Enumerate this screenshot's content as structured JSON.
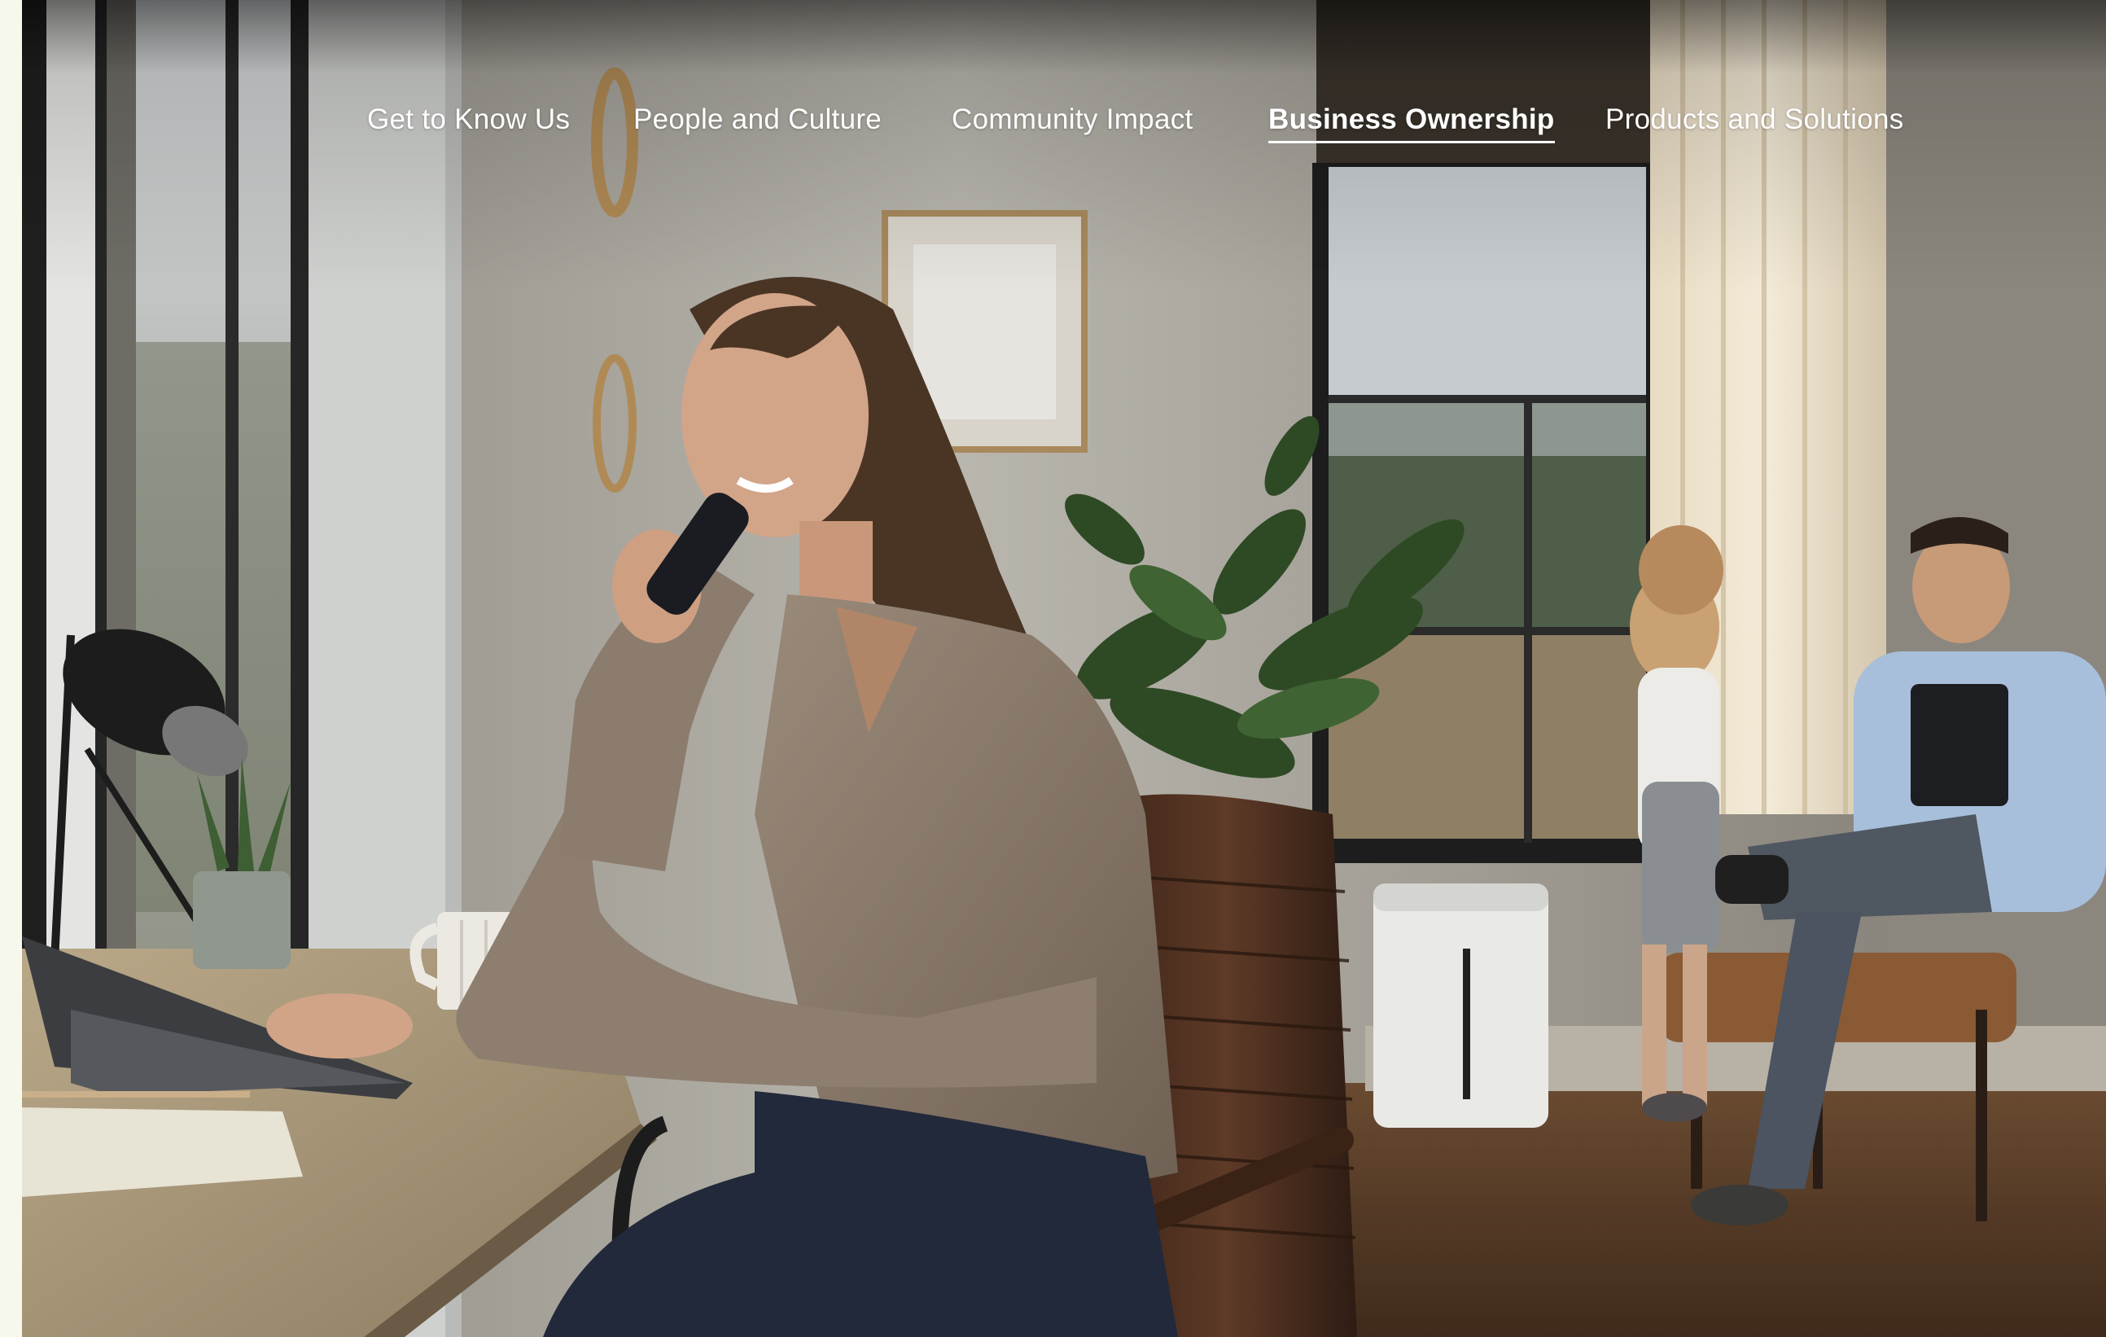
{
  "nav": {
    "items": [
      {
        "label": "Get to Know Us"
      },
      {
        "label": "People and Culture"
      },
      {
        "label": "Community Impact"
      },
      {
        "label": "Business Ownership",
        "active": true
      },
      {
        "label": "Products and Solutions"
      }
    ]
  },
  "colors": {
    "page_background": "#f7f8ec",
    "nav_text": "#ffffff",
    "active_underline": "#ffffff"
  }
}
